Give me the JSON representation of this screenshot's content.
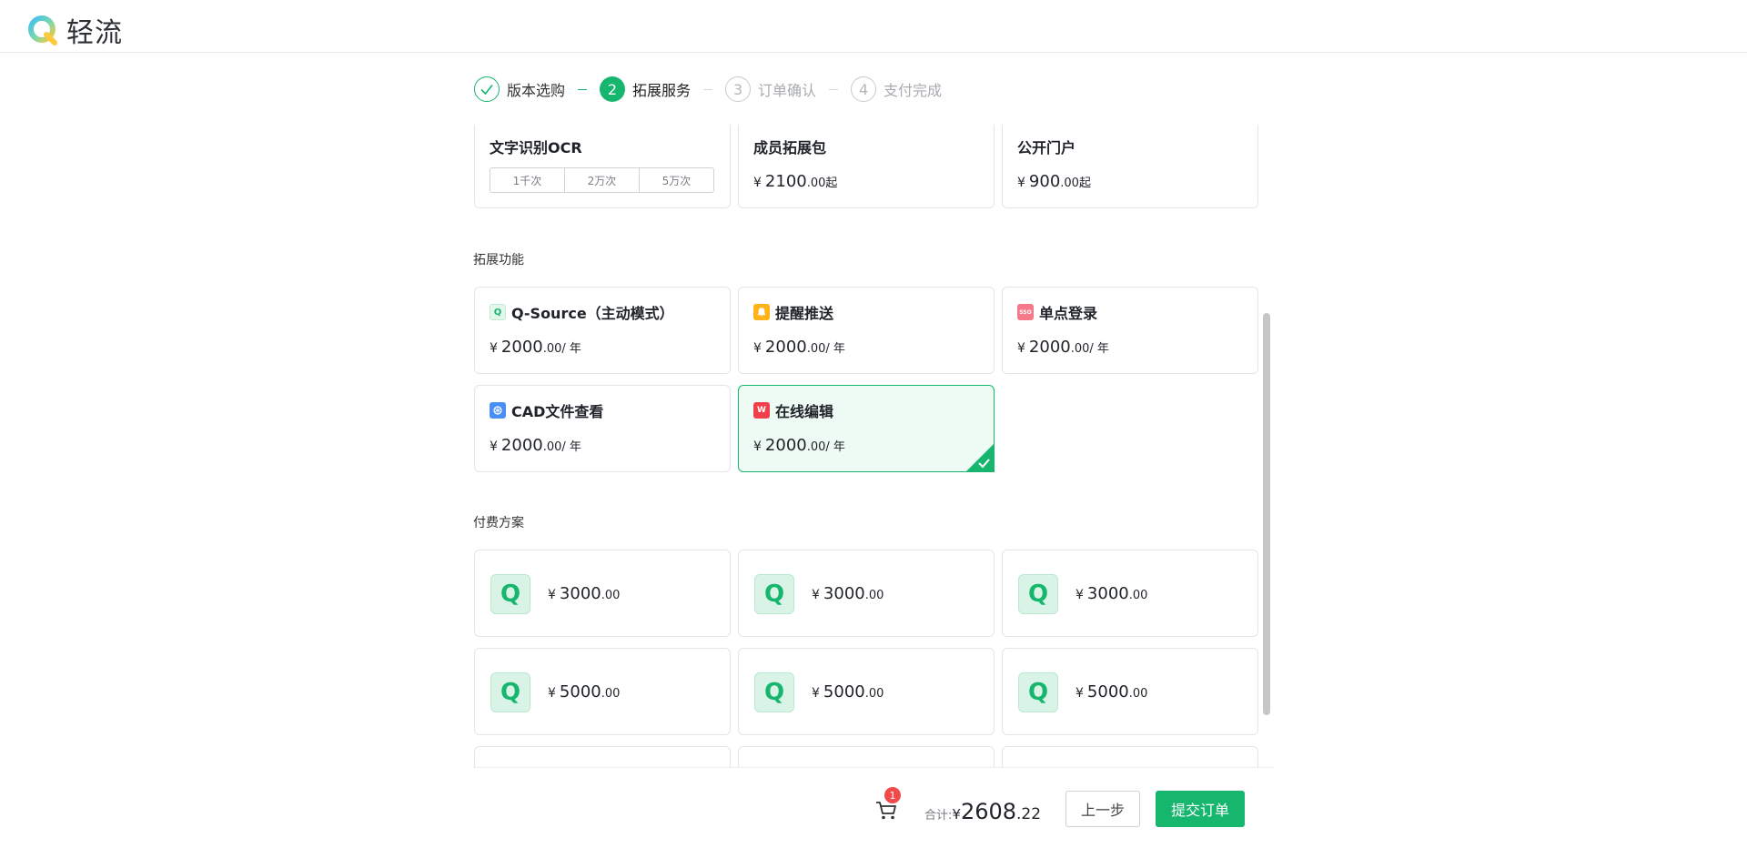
{
  "app": {
    "brand": "轻流"
  },
  "steps": [
    {
      "num": "",
      "label": "版本选购",
      "state": "done"
    },
    {
      "num": "2",
      "label": "拓展服务",
      "state": "active"
    },
    {
      "num": "3",
      "label": "订单确认",
      "state": "todo"
    },
    {
      "num": "4",
      "label": "支付完成",
      "state": "todo"
    }
  ],
  "top_services": [
    {
      "title": "文字识别OCR",
      "options": [
        "1千次",
        "2万次",
        "5万次"
      ]
    },
    {
      "title": "成员拓展包",
      "currency": "¥",
      "int": "2100",
      "dec": ".00",
      "suffix": "起"
    },
    {
      "title": "公开门户",
      "currency": "¥",
      "int": "900",
      "dec": ".00",
      "suffix": "起"
    }
  ],
  "features_title": "拓展功能",
  "features": [
    {
      "icon": "q-source-icon",
      "icon_text": "Q",
      "title": "Q-Source（主动模式）",
      "currency": "¥",
      "int": "2000",
      "dec": ".00",
      "unit": "/ 年"
    },
    {
      "icon": "bell-icon",
      "icon_text": "",
      "title": "提醒推送",
      "currency": "¥",
      "int": "2000",
      "dec": ".00",
      "unit": "/ 年"
    },
    {
      "icon": "sso-icon",
      "icon_text": "SSO",
      "title": "单点登录",
      "currency": "¥",
      "int": "2000",
      "dec": ".00",
      "unit": "/ 年"
    },
    {
      "icon": "cad-icon",
      "icon_text": "",
      "title": "CAD文件查看",
      "currency": "¥",
      "int": "2000",
      "dec": ".00",
      "unit": "/ 年"
    },
    {
      "icon": "wps-icon",
      "icon_text": "W",
      "title": "在线编辑",
      "currency": "¥",
      "int": "2000",
      "dec": ".00",
      "unit": "/ 年",
      "selected": true
    }
  ],
  "plans_title": "付费方案",
  "plans": [
    {
      "logo": "Q",
      "currency": "¥",
      "int": "3000",
      "dec": ".00"
    },
    {
      "logo": "Q",
      "currency": "¥",
      "int": "3000",
      "dec": ".00"
    },
    {
      "logo": "Q",
      "currency": "¥",
      "int": "3000",
      "dec": ".00"
    },
    {
      "logo": "Q",
      "currency": "¥",
      "int": "5000",
      "dec": ".00"
    },
    {
      "logo": "Q",
      "currency": "¥",
      "int": "5000",
      "dec": ".00"
    },
    {
      "logo": "Q",
      "currency": "¥",
      "int": "5000",
      "dec": ".00"
    }
  ],
  "footer": {
    "cart_count": "1",
    "total_label": "合计:",
    "currency": "¥",
    "total_int": "2608",
    "total_dec": ".22",
    "prev_label": "上一步",
    "submit_label": "提交订单"
  },
  "colors": {
    "accent": "#16b66e",
    "badge": "#f04a4a"
  }
}
